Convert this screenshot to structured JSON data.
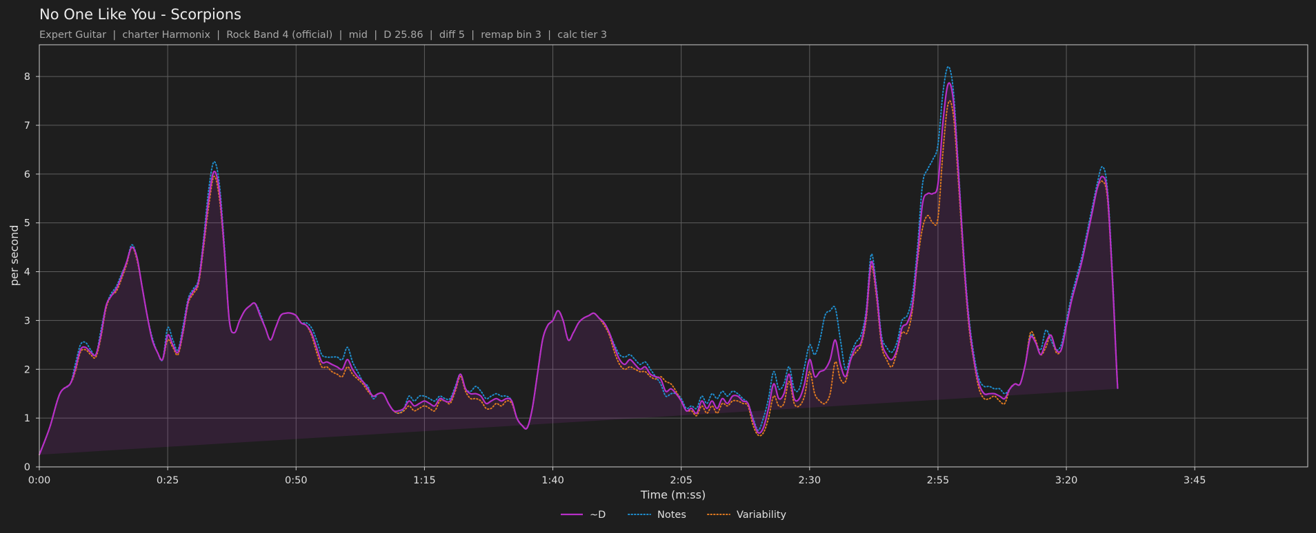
{
  "chart_data": {
    "type": "line",
    "title": "No One Like You - Scorpions",
    "subtitle": "Expert Guitar  |  charter Harmonix  |  Rock Band 4 (official)  |  mid  |  D 25.86  |  diff 5  |  remap bin 3  |  calc tier 3",
    "xlabel": "Time (m:ss)",
    "ylabel": "per second",
    "xlim": [
      0,
      247
    ],
    "ylim": [
      0,
      8.65
    ],
    "x_ticks": [
      0,
      25,
      50,
      75,
      100,
      125,
      150,
      175,
      200,
      225
    ],
    "x_tick_labels": [
      "0:00",
      "0:25",
      "0:50",
      "1:15",
      "1:40",
      "2:05",
      "2:30",
      "2:55",
      "3:20",
      "3:45"
    ],
    "y_ticks": [
      0,
      1,
      2,
      3,
      4,
      5,
      6,
      7,
      8
    ],
    "grid": true,
    "legend_position": "bottom-center",
    "x": [
      0,
      2,
      4,
      6,
      7,
      8,
      9,
      10,
      11,
      12,
      13,
      14,
      15,
      16,
      17,
      18,
      19,
      20,
      21,
      22,
      23,
      24,
      25,
      26,
      27,
      28,
      29,
      30,
      31,
      32,
      33,
      34,
      35,
      36,
      37,
      38,
      39,
      40,
      41,
      42,
      43,
      44,
      45,
      46,
      47,
      48,
      49,
      50,
      51,
      52,
      53,
      54,
      55,
      56,
      57,
      58,
      59,
      60,
      61,
      62,
      63,
      64,
      65,
      66,
      67,
      68,
      69,
      70,
      71,
      72,
      73,
      74,
      75,
      76,
      77,
      78,
      79,
      80,
      81,
      82,
      83,
      84,
      85,
      86,
      87,
      88,
      89,
      90,
      91,
      92,
      93,
      94,
      95,
      96,
      97,
      98,
      99,
      100,
      101,
      102,
      103,
      104,
      105,
      106,
      107,
      108,
      109,
      110,
      111,
      112,
      113,
      114,
      115,
      116,
      117,
      118,
      119,
      120,
      121,
      122,
      123,
      124,
      125,
      126,
      127,
      128,
      129,
      130,
      131,
      132,
      133,
      134,
      135,
      136,
      137,
      138,
      139,
      140,
      141,
      142,
      143,
      144,
      145,
      146,
      147,
      148,
      149,
      150,
      151,
      152,
      153,
      154,
      155,
      156,
      157,
      158,
      159,
      160,
      161,
      162,
      163,
      164,
      165,
      166,
      167,
      168,
      169,
      170,
      171,
      172,
      173,
      174,
      175,
      176,
      177,
      178,
      179,
      180,
      181,
      182,
      183,
      184,
      185,
      186,
      187,
      188,
      189,
      190,
      191,
      192,
      193,
      194,
      195,
      196,
      197,
      198,
      199,
      200,
      201,
      202,
      203,
      204,
      205,
      206,
      207,
      208,
      209,
      210,
      211,
      212,
      213,
      214,
      215,
      216,
      217,
      218,
      219,
      220,
      221,
      222,
      223,
      224,
      225,
      226,
      227,
      228,
      229,
      230,
      231,
      232,
      233,
      234,
      235,
      236,
      237,
      238,
      239,
      240,
      241,
      242,
      243,
      244,
      245,
      246,
      247
    ],
    "series": [
      {
        "name": "~D",
        "color": "#b82fc8",
        "style": "solid",
        "values": [
          0.25,
          0.8,
          1.5,
          1.7,
          2.0,
          2.4,
          2.45,
          2.35,
          2.3,
          2.7,
          3.3,
          3.5,
          3.65,
          3.9,
          4.2,
          4.5,
          4.3,
          3.7,
          3.1,
          2.6,
          2.35,
          2.2,
          2.7,
          2.5,
          2.35,
          2.8,
          3.4,
          3.6,
          3.8,
          4.6,
          5.5,
          6.05,
          5.7,
          4.5,
          3.0,
          2.75,
          3.0,
          3.2,
          3.3,
          3.35,
          3.1,
          2.85,
          2.6,
          2.85,
          3.1,
          3.15,
          3.15,
          3.1,
          2.95,
          2.9,
          2.75,
          2.45,
          2.15,
          2.15,
          2.1,
          2.05,
          2.0,
          2.2,
          2.0,
          1.85,
          1.75,
          1.6,
          1.45,
          1.5,
          1.5,
          1.3,
          1.15,
          1.15,
          1.2,
          1.35,
          1.25,
          1.3,
          1.35,
          1.3,
          1.25,
          1.4,
          1.35,
          1.35,
          1.6,
          1.9,
          1.6,
          1.5,
          1.5,
          1.45,
          1.3,
          1.35,
          1.4,
          1.35,
          1.4,
          1.35,
          1.0,
          0.85,
          0.8,
          1.2,
          1.9,
          2.6,
          2.9,
          3.0,
          3.2,
          3.0,
          2.6,
          2.75,
          2.95,
          3.05,
          3.1,
          3.15,
          3.05,
          2.95,
          2.75,
          2.45,
          2.2,
          2.1,
          2.2,
          2.1,
          2.0,
          2.05,
          1.9,
          1.85,
          1.8,
          1.55,
          1.6,
          1.5,
          1.35,
          1.15,
          1.2,
          1.1,
          1.35,
          1.2,
          1.35,
          1.2,
          1.4,
          1.3,
          1.45,
          1.45,
          1.35,
          1.3,
          0.95,
          0.7,
          0.8,
          1.2,
          1.7,
          1.4,
          1.5,
          1.9,
          1.4,
          1.4,
          1.7,
          2.2,
          1.85,
          1.95,
          2.0,
          2.2,
          2.6,
          2.1,
          1.85,
          2.2,
          2.45,
          2.55,
          3.1,
          4.2,
          3.6,
          2.6,
          2.3,
          2.2,
          2.4,
          2.85,
          2.95,
          3.3,
          4.3,
          5.4,
          5.6,
          5.6,
          5.8,
          7.1,
          7.85,
          7.5,
          6.0,
          4.3,
          3.0,
          2.2,
          1.7,
          1.5,
          1.5,
          1.5,
          1.45,
          1.4,
          1.6,
          1.7,
          1.7,
          2.1,
          2.65,
          2.55,
          2.3,
          2.55,
          2.7,
          2.4,
          2.4,
          2.9,
          3.4,
          3.8,
          4.2,
          4.7,
          5.2,
          5.7,
          5.95,
          5.6,
          3.8,
          1.6,
          0.25
        ]
      },
      {
        "name": "Notes",
        "color": "#1f8fd0",
        "style": "dotted",
        "values": [
          0.25,
          0.8,
          1.5,
          1.7,
          2.1,
          2.5,
          2.55,
          2.4,
          2.3,
          2.8,
          3.3,
          3.55,
          3.7,
          3.95,
          4.2,
          4.55,
          4.3,
          3.7,
          3.1,
          2.65,
          2.35,
          2.2,
          2.85,
          2.6,
          2.4,
          2.9,
          3.45,
          3.65,
          3.85,
          4.7,
          5.7,
          6.25,
          5.85,
          4.6,
          3.0,
          2.75,
          3.0,
          3.2,
          3.3,
          3.35,
          3.15,
          2.85,
          2.6,
          2.85,
          3.1,
          3.15,
          3.15,
          3.1,
          2.95,
          2.95,
          2.85,
          2.6,
          2.3,
          2.25,
          2.25,
          2.25,
          2.2,
          2.45,
          2.15,
          1.95,
          1.75,
          1.65,
          1.4,
          1.5,
          1.5,
          1.3,
          1.15,
          1.1,
          1.2,
          1.45,
          1.35,
          1.45,
          1.45,
          1.4,
          1.35,
          1.45,
          1.4,
          1.4,
          1.65,
          1.9,
          1.6,
          1.55,
          1.65,
          1.55,
          1.4,
          1.45,
          1.5,
          1.45,
          1.45,
          1.35,
          1.0,
          0.85,
          0.8,
          1.2,
          1.9,
          2.6,
          2.9,
          3.0,
          3.2,
          3.0,
          2.6,
          2.75,
          2.95,
          3.05,
          3.1,
          3.15,
          3.05,
          2.95,
          2.75,
          2.5,
          2.3,
          2.25,
          2.3,
          2.2,
          2.1,
          2.15,
          2.0,
          1.85,
          1.7,
          1.45,
          1.5,
          1.5,
          1.4,
          1.2,
          1.25,
          1.2,
          1.45,
          1.3,
          1.5,
          1.4,
          1.55,
          1.45,
          1.55,
          1.5,
          1.4,
          1.3,
          1.0,
          0.75,
          1.0,
          1.4,
          1.95,
          1.6,
          1.7,
          2.05,
          1.6,
          1.6,
          2.05,
          2.5,
          2.3,
          2.6,
          3.1,
          3.2,
          3.25,
          2.6,
          2.0,
          2.3,
          2.55,
          2.7,
          3.2,
          4.35,
          3.7,
          2.7,
          2.45,
          2.35,
          2.55,
          3.0,
          3.1,
          3.5,
          4.5,
          5.8,
          6.1,
          6.3,
          6.6,
          7.7,
          8.2,
          7.7,
          6.1,
          4.4,
          3.1,
          2.3,
          1.8,
          1.65,
          1.65,
          1.6,
          1.6,
          1.5,
          1.6,
          1.7,
          1.7,
          2.1,
          2.7,
          2.55,
          2.4,
          2.8,
          2.6,
          2.4,
          2.5,
          3.0,
          3.5,
          3.9,
          4.3,
          4.8,
          5.3,
          5.8,
          6.15,
          5.7,
          3.9,
          1.6,
          0.25
        ]
      },
      {
        "name": "Variability",
        "color": "#e07a20",
        "style": "dotted",
        "values": [
          0.25,
          0.8,
          1.5,
          1.7,
          1.95,
          2.35,
          2.4,
          2.3,
          2.25,
          2.65,
          3.25,
          3.5,
          3.6,
          3.85,
          4.15,
          4.5,
          4.25,
          3.7,
          3.1,
          2.6,
          2.35,
          2.2,
          2.6,
          2.45,
          2.3,
          2.75,
          3.35,
          3.55,
          3.75,
          4.5,
          5.35,
          5.95,
          5.55,
          4.45,
          3.0,
          2.75,
          3.0,
          3.2,
          3.3,
          3.35,
          3.1,
          2.85,
          2.6,
          2.85,
          3.1,
          3.15,
          3.15,
          3.1,
          2.95,
          2.9,
          2.7,
          2.35,
          2.05,
          2.05,
          1.95,
          1.9,
          1.85,
          2.05,
          1.9,
          1.8,
          1.7,
          1.55,
          1.45,
          1.5,
          1.5,
          1.3,
          1.15,
          1.1,
          1.15,
          1.25,
          1.15,
          1.2,
          1.25,
          1.2,
          1.15,
          1.35,
          1.35,
          1.3,
          1.55,
          1.85,
          1.55,
          1.4,
          1.4,
          1.35,
          1.2,
          1.2,
          1.3,
          1.25,
          1.35,
          1.3,
          1.0,
          0.85,
          0.8,
          1.2,
          1.9,
          2.6,
          2.9,
          3.0,
          3.2,
          3.0,
          2.6,
          2.75,
          2.95,
          3.05,
          3.1,
          3.15,
          3.05,
          2.9,
          2.7,
          2.35,
          2.1,
          2.0,
          2.05,
          2.0,
          1.95,
          1.95,
          1.85,
          1.8,
          1.85,
          1.75,
          1.7,
          1.55,
          1.35,
          1.15,
          1.15,
          1.05,
          1.25,
          1.1,
          1.25,
          1.1,
          1.3,
          1.25,
          1.35,
          1.35,
          1.3,
          1.25,
          0.85,
          0.65,
          0.7,
          1.0,
          1.45,
          1.25,
          1.3,
          1.75,
          1.3,
          1.25,
          1.45,
          1.95,
          1.5,
          1.35,
          1.3,
          1.5,
          2.15,
          1.8,
          1.75,
          2.2,
          2.35,
          2.5,
          3.0,
          4.1,
          3.5,
          2.5,
          2.2,
          2.05,
          2.35,
          2.75,
          2.75,
          3.2,
          4.2,
          4.9,
          5.15,
          5.0,
          5.1,
          6.5,
          7.45,
          7.2,
          5.8,
          4.2,
          2.9,
          2.15,
          1.6,
          1.4,
          1.4,
          1.45,
          1.35,
          1.3,
          1.6,
          1.7,
          1.7,
          2.1,
          2.75,
          2.6,
          2.3,
          2.45,
          2.7,
          2.35,
          2.4,
          2.9,
          3.4,
          3.8,
          4.2,
          4.7,
          5.2,
          5.7,
          5.85,
          5.5,
          3.75,
          1.6,
          0.25
        ]
      }
    ]
  }
}
